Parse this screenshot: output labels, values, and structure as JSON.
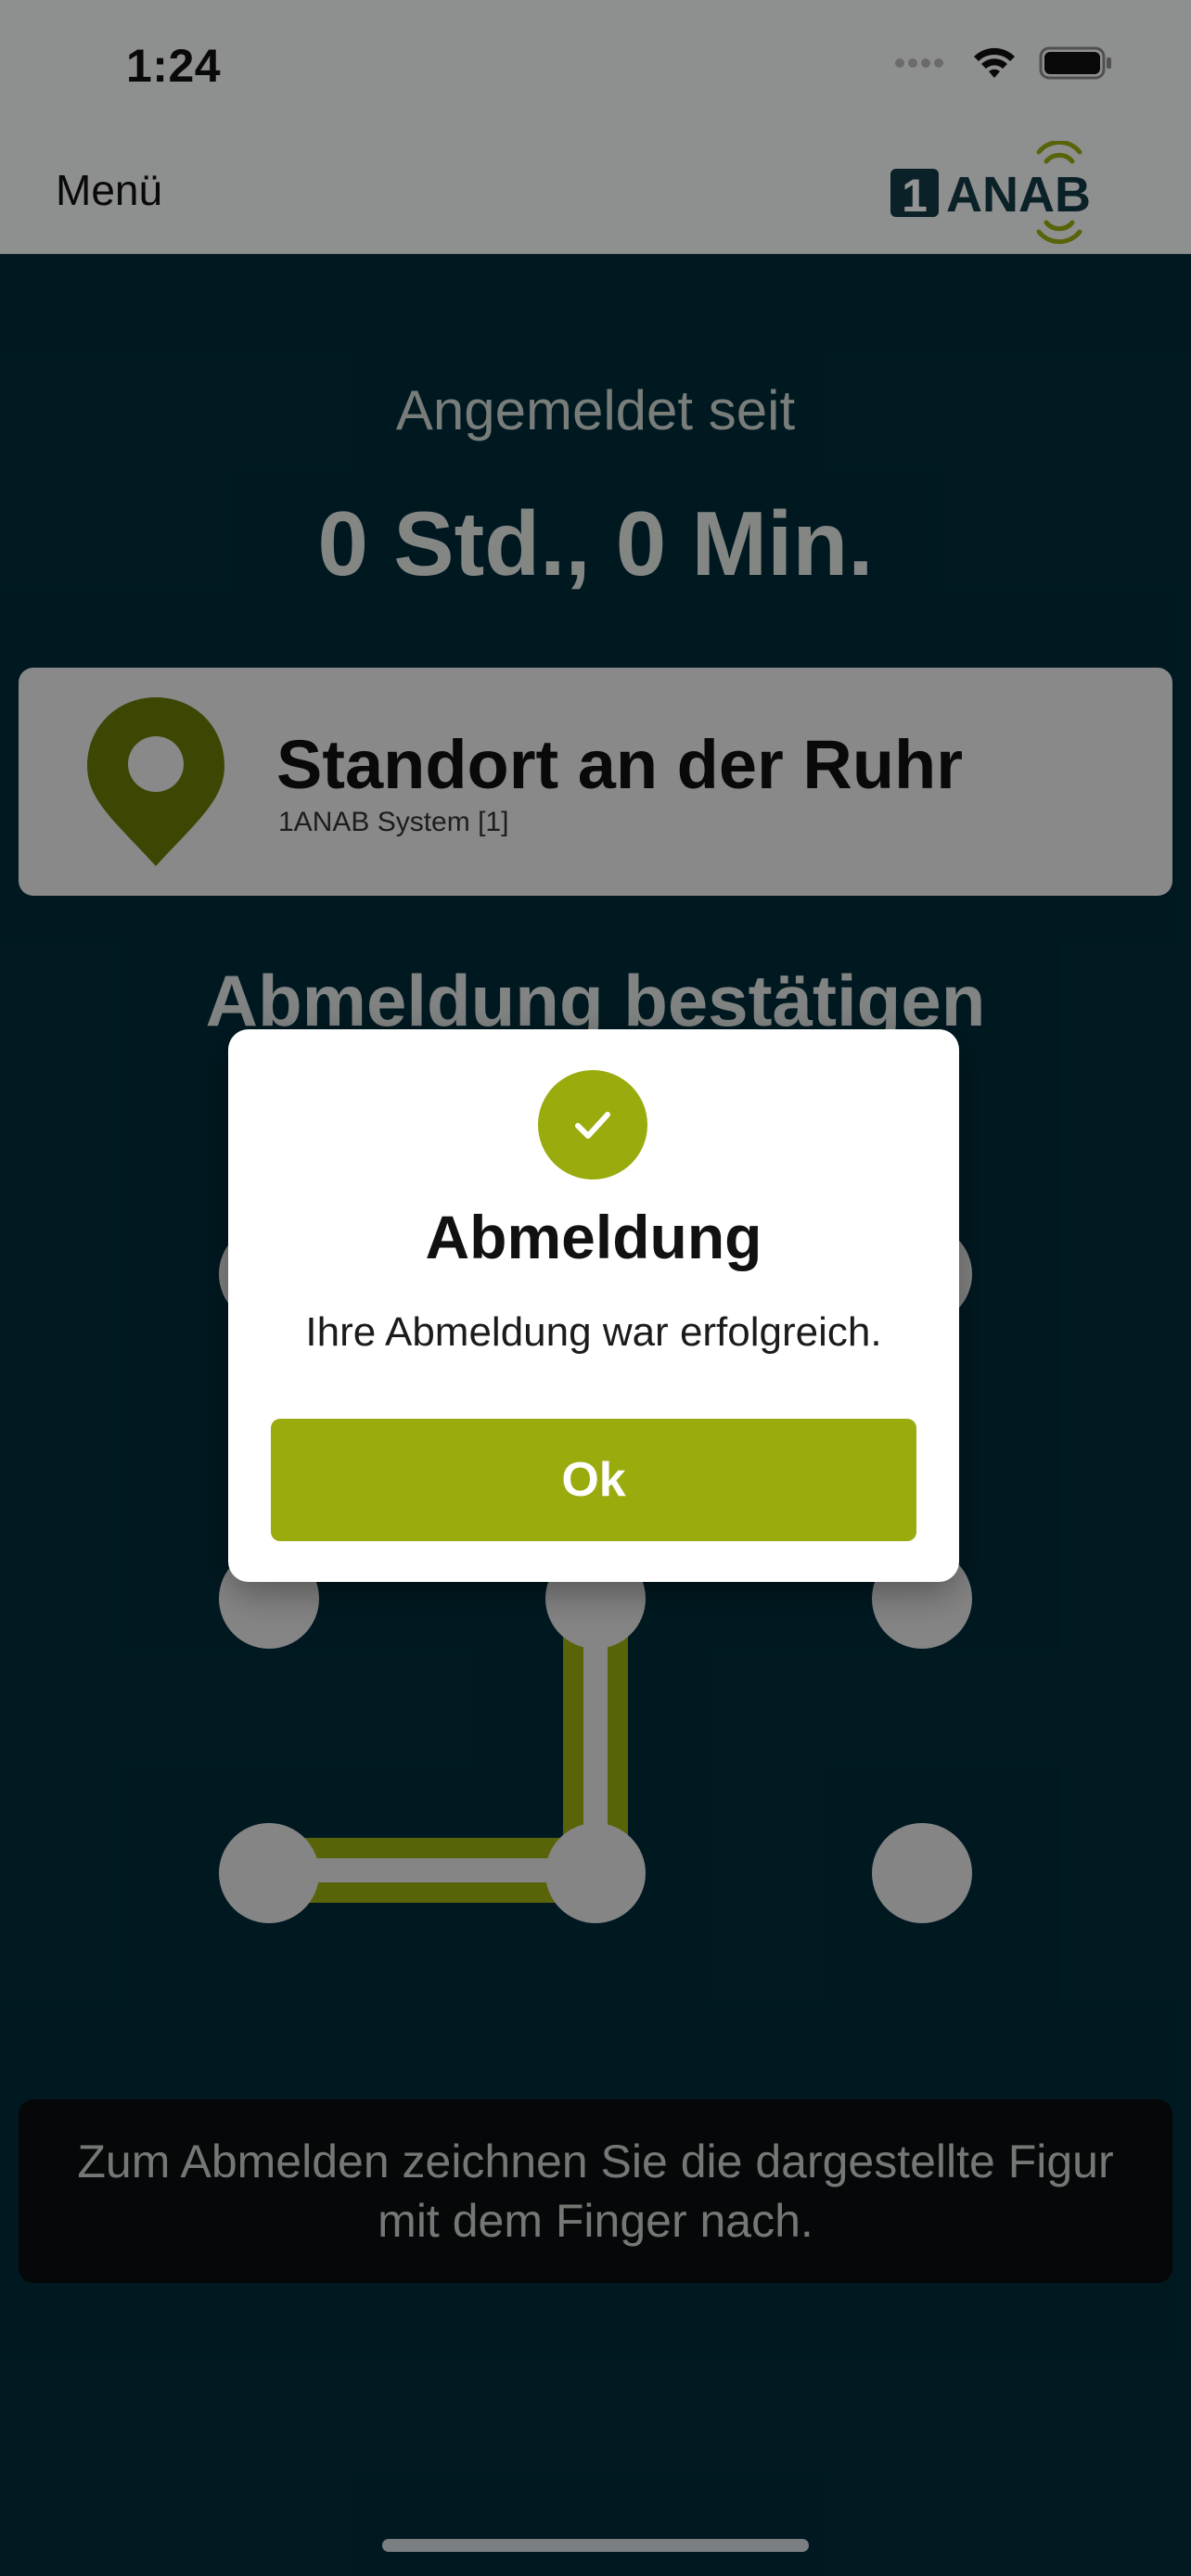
{
  "status_bar": {
    "time": "1:24",
    "icons": [
      "signal-icon",
      "wifi-icon",
      "battery-icon"
    ]
  },
  "nav": {
    "menu_label": "Menü",
    "logo_text": "ANAB",
    "logo_number": "1"
  },
  "session": {
    "since_label": "Angemeldet seit",
    "duration": "0 Std., 0 Min."
  },
  "location": {
    "name": "Standort an der Ruhr",
    "system": "1ANAB System [1]",
    "icon": "map-pin-icon"
  },
  "confirm": {
    "title": "Abmeldung bestätigen"
  },
  "pattern": {
    "rows": 3,
    "cols": 3,
    "path": [
      "r1c1",
      "r1c2",
      "r2c2"
    ]
  },
  "hint": {
    "text": "Zum Abmelden zeichnen Sie die dargestellte Figur mit dem Finger nach."
  },
  "alert": {
    "icon": "check-icon",
    "title": "Abmeldung",
    "message": "Ihre Abmeldung war erfolgreich.",
    "ok_label": "Ok"
  },
  "colors": {
    "accent": "#9aab0e",
    "background": "#012c39",
    "navbar": "#f5f6f7"
  }
}
